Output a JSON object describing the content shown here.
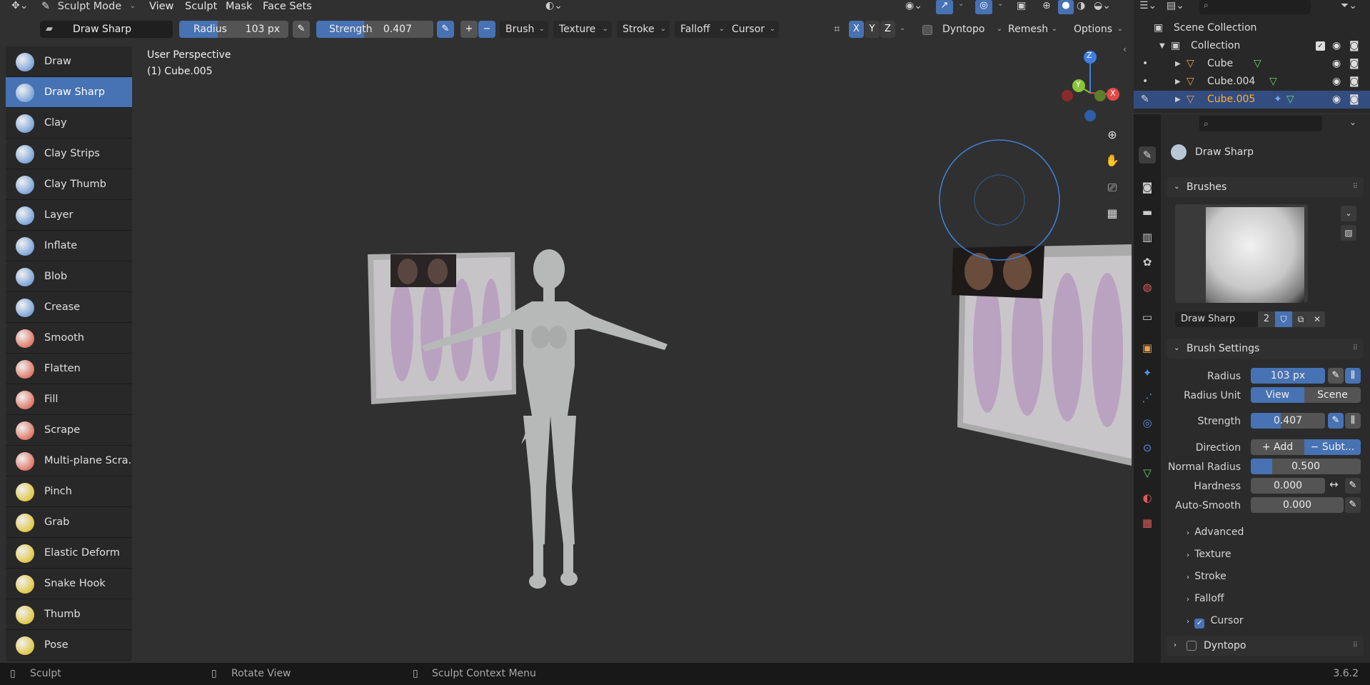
{
  "header": {
    "mode": "Sculpt Mode",
    "menus": [
      "View",
      "Sculpt",
      "Mask",
      "Face Sets"
    ]
  },
  "toolheader": {
    "brush_name": "Draw Sharp",
    "radius_label": "Radius",
    "radius_value": "103 px",
    "strength_label": "Strength",
    "strength_value": "0.407",
    "strength_fraction": 0.407,
    "plus": "+",
    "minus": "−",
    "dropdowns": [
      "Brush",
      "Texture",
      "Stroke",
      "Falloff",
      "Cursor"
    ],
    "axes": [
      "X",
      "Y",
      "Z"
    ],
    "dyntopo": "Dyntopo",
    "remesh": "Remesh",
    "options": "Options"
  },
  "tools": [
    {
      "label": "Draw",
      "color": "#7fa6d9"
    },
    {
      "label": "Draw Sharp",
      "color": "#7fa6d9",
      "active": true
    },
    {
      "label": "Clay",
      "color": "#7fa6d9"
    },
    {
      "label": "Clay Strips",
      "color": "#7fa6d9"
    },
    {
      "label": "Clay Thumb",
      "color": "#7fa6d9"
    },
    {
      "label": "Layer",
      "color": "#7fa6d9"
    },
    {
      "label": "Inflate",
      "color": "#7fa6d9"
    },
    {
      "label": "Blob",
      "color": "#7fa6d9"
    },
    {
      "label": "Crease",
      "color": "#7fa6d9"
    },
    {
      "label": "Smooth",
      "color": "#e07a6a"
    },
    {
      "label": "Flatten",
      "color": "#e07a6a"
    },
    {
      "label": "Fill",
      "color": "#e07a6a"
    },
    {
      "label": "Scrape",
      "color": "#e07a6a"
    },
    {
      "label": "Multi-plane Scra...",
      "color": "#e07a6a"
    },
    {
      "label": "Pinch",
      "color": "#e0c84a"
    },
    {
      "label": "Grab",
      "color": "#e0c84a"
    },
    {
      "label": "Elastic Deform",
      "color": "#e0c84a"
    },
    {
      "label": "Snake Hook",
      "color": "#e0c84a"
    },
    {
      "label": "Thumb",
      "color": "#e0c84a"
    },
    {
      "label": "Pose",
      "color": "#e0c84a"
    }
  ],
  "viewport": {
    "view_name": "User Perspective",
    "object_name": "(1) Cube.005",
    "gizmo": {
      "x": "X",
      "y": "Y",
      "z": "Z"
    }
  },
  "outliner": {
    "scene_collection": "Scene Collection",
    "collection": "Collection",
    "objects": [
      "Cube",
      "Cube.004",
      "Cube.005"
    ]
  },
  "properties": {
    "brush_name": "Draw Sharp",
    "brushes_panel": "Brushes",
    "brush_field": "Draw Sharp",
    "brush_users": "2",
    "brush_settings_panel": "Brush Settings",
    "radius_label": "Radius",
    "radius_value": "103 px",
    "radius_unit_label": "Radius Unit",
    "radius_unit_view": "View",
    "radius_unit_scene": "Scene",
    "strength_label": "Strength",
    "strength_value": "0.407",
    "direction_label": "Direction",
    "direction_add": "Add",
    "direction_subtract": "Subt...",
    "normal_radius_label": "Normal Radius",
    "normal_radius_value": "0.500",
    "normal_radius_fraction": 0.5,
    "hardness_label": "Hardness",
    "hardness_value": "0.000",
    "autosmooth_label": "Auto-Smooth",
    "autosmooth_value": "0.000",
    "subpanels": [
      "Advanced",
      "Texture",
      "Stroke",
      "Falloff"
    ],
    "cursor_label": "Cursor",
    "dyntopo_label": "Dyntopo"
  },
  "status": {
    "left": "Sculpt",
    "middle": "Rotate View",
    "right": "Sculpt Context Menu",
    "version": "3.6.2"
  },
  "colors": {
    "accent": "#4772b3",
    "x_axis": "#e04a4a",
    "y_axis": "#8ac53a",
    "z_axis": "#3f7fe0"
  }
}
